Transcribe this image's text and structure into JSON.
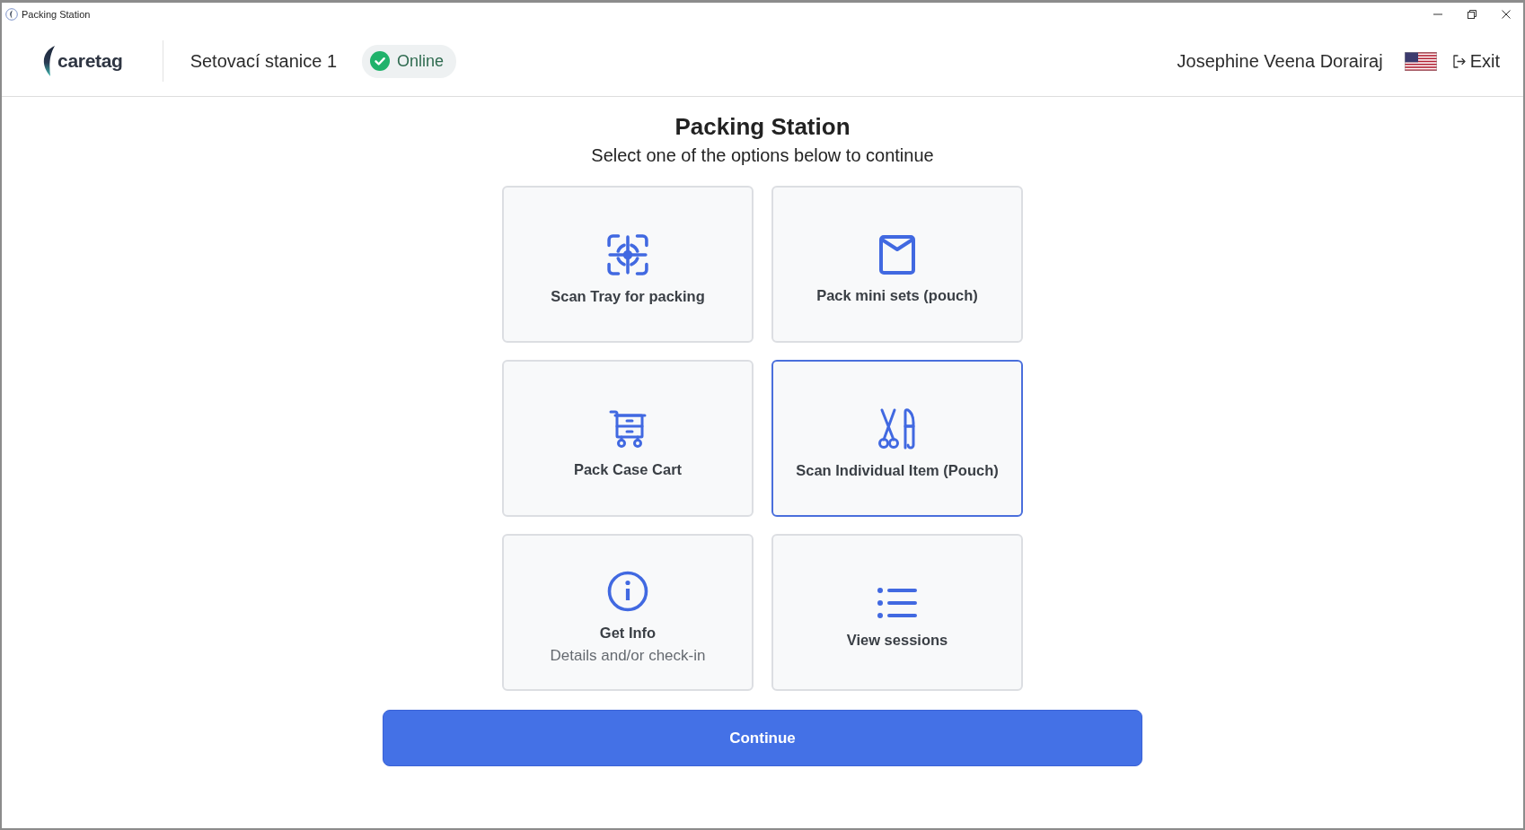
{
  "window": {
    "title": "Packing Station"
  },
  "header": {
    "brand": "caretag",
    "station": "Setovací stanice 1",
    "connection": {
      "online": true,
      "label": "Online"
    },
    "user": "Josephine Veena Dorairaj",
    "exit": "Exit"
  },
  "page": {
    "title": "Packing Station",
    "subtitle": "Select one of the options below to continue"
  },
  "options": [
    {
      "kind": "scan-tray",
      "label": "Scan Tray for packing",
      "selected": false
    },
    {
      "kind": "mini-sets",
      "label": "Pack mini sets (pouch)",
      "selected": false
    },
    {
      "kind": "case-cart",
      "label": "Pack Case Cart",
      "selected": false
    },
    {
      "kind": "single-item",
      "label": "Scan Individual Item (Pouch)",
      "selected": true
    },
    {
      "kind": "info",
      "label": "Get Info",
      "detail": "Details and/or check-in",
      "selected": false
    },
    {
      "kind": "sessions",
      "label": "View sessions",
      "selected": false
    }
  ],
  "continue_button": {
    "label": "Continue"
  }
}
